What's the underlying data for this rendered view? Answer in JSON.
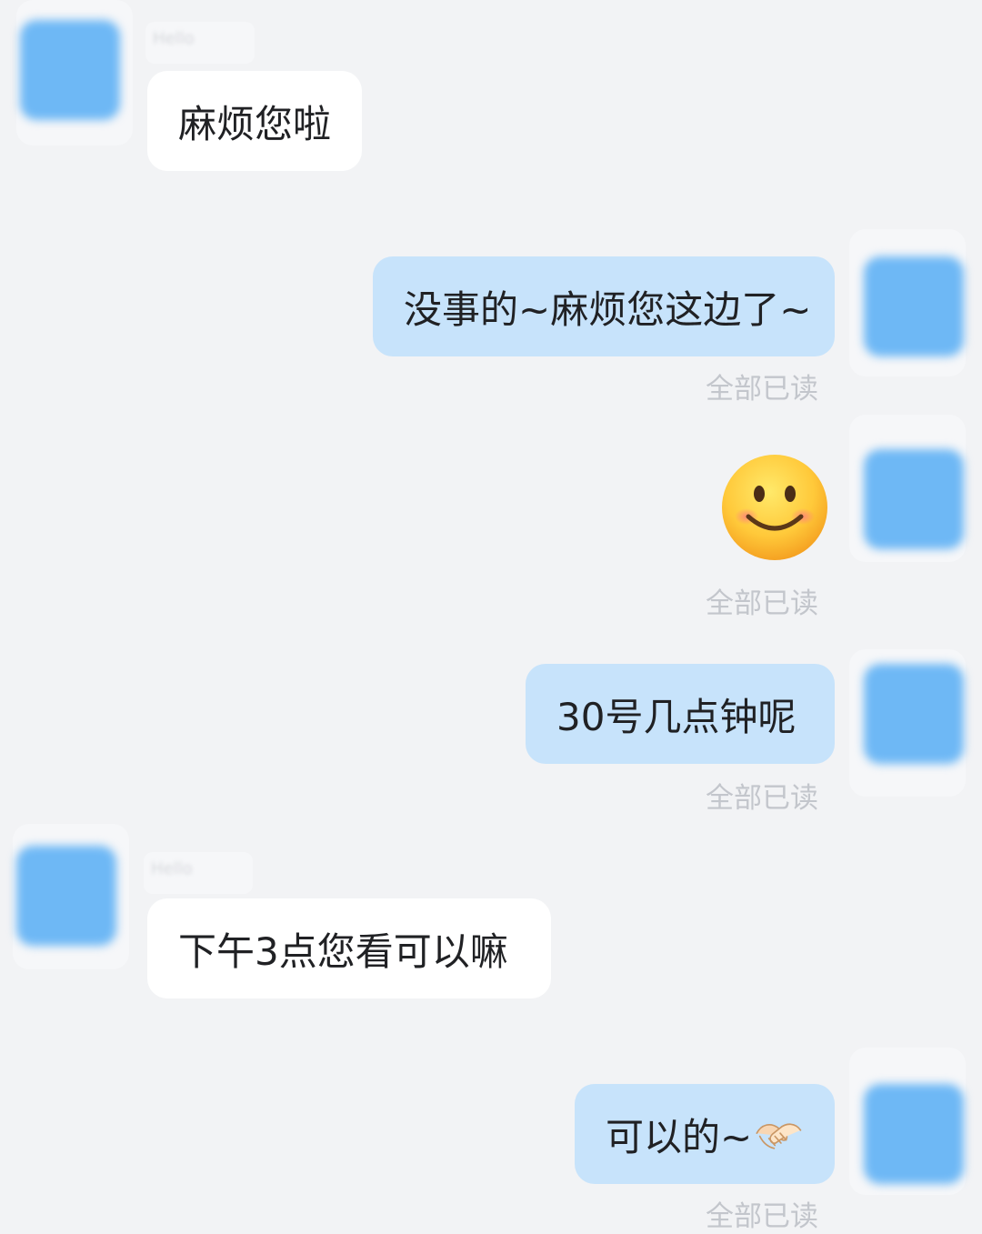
{
  "messages": [
    {
      "side": "left",
      "name": "Hello",
      "text": "麻烦您啦"
    },
    {
      "side": "right",
      "text": "没事的~麻烦您这边了~",
      "status": "全部已读"
    },
    {
      "side": "right",
      "emoji": "slightly-smiling-face-icon",
      "status": "全部已读"
    },
    {
      "side": "right",
      "text": "30号几点钟呢",
      "status": "全部已读"
    },
    {
      "side": "left",
      "name": "Hello",
      "text": "下午3点您看可以嘛"
    },
    {
      "side": "right",
      "text": "可以的~",
      "emoji": "handshake-icon",
      "status": "全部已读"
    }
  ],
  "colors": {
    "background": "#f2f3f5",
    "incoming_bubble": "#ffffff",
    "outgoing_bubble": "#c7e3fb",
    "avatar": "#6eb8f5",
    "read_status": "#c3c6cc"
  }
}
